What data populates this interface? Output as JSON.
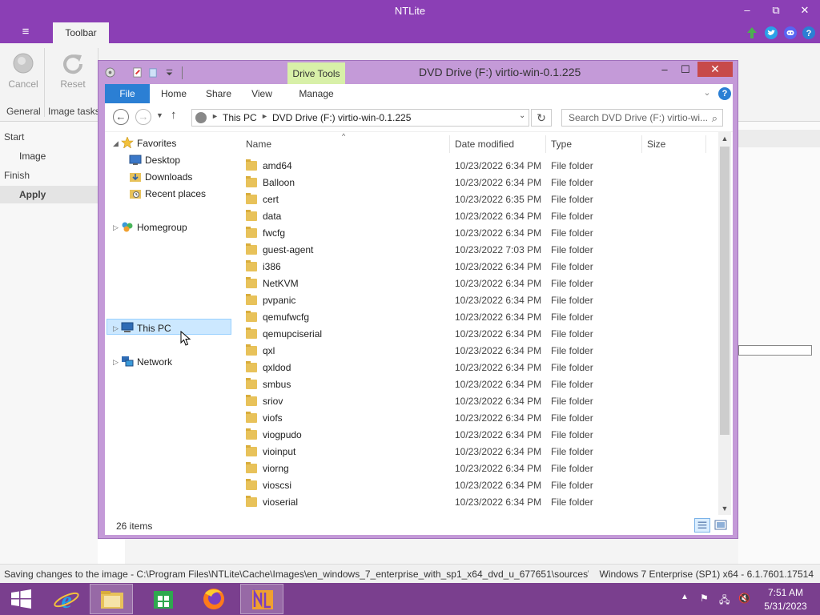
{
  "ntlite": {
    "title": "NTLite",
    "window_controls": {
      "minimize": "–",
      "restore": "⧉",
      "close": "✕"
    },
    "menu_glyph": "≡",
    "ribbon_tab": "Toolbar",
    "ribbon": {
      "cancel": "Cancel",
      "reset": "Reset",
      "group_general": "General",
      "group_image_tasks": "Image tasks"
    },
    "nav": {
      "start": "Start",
      "image": "Image",
      "finish": "Finish",
      "apply": "Apply"
    },
    "status_left": "Saving changes to the image - C:\\Program Files\\NTLite\\Cache\\Images\\en_windows_7_enterprise_with_sp1_x64_dvd_u_677651\\sources\\i...",
    "status_right": "Windows 7 Enterprise (SP1) x64 - 6.1.7601.17514"
  },
  "explorer": {
    "title": "DVD Drive (F:) virtio-win-0.1.225",
    "contextual_tab": "Drive Tools",
    "window_controls": {
      "minimize": "–",
      "maximize": "☐",
      "close": "✕"
    },
    "tabs": {
      "file": "File",
      "home": "Home",
      "share": "Share",
      "view": "View",
      "manage": "Manage"
    },
    "help": "?",
    "address": {
      "parts": [
        "This PC",
        "DVD Drive (F:) virtio-win-0.1.225"
      ],
      "sep": "►"
    },
    "search_placeholder": "Search DVD Drive (F:) virtio-wi...",
    "nav_tree": {
      "favorites": "Favorites",
      "desktop": "Desktop",
      "downloads": "Downloads",
      "recent": "Recent places",
      "homegroup": "Homegroup",
      "this_pc": "This PC",
      "network": "Network"
    },
    "columns": {
      "name": "Name",
      "date": "Date modified",
      "type": "Type",
      "size": "Size"
    },
    "files": [
      {
        "name": "amd64",
        "date": "10/23/2022 6:34 PM",
        "type": "File folder"
      },
      {
        "name": "Balloon",
        "date": "10/23/2022 6:34 PM",
        "type": "File folder"
      },
      {
        "name": "cert",
        "date": "10/23/2022 6:35 PM",
        "type": "File folder"
      },
      {
        "name": "data",
        "date": "10/23/2022 6:34 PM",
        "type": "File folder"
      },
      {
        "name": "fwcfg",
        "date": "10/23/2022 6:34 PM",
        "type": "File folder"
      },
      {
        "name": "guest-agent",
        "date": "10/23/2022 7:03 PM",
        "type": "File folder"
      },
      {
        "name": "i386",
        "date": "10/23/2022 6:34 PM",
        "type": "File folder"
      },
      {
        "name": "NetKVM",
        "date": "10/23/2022 6:34 PM",
        "type": "File folder"
      },
      {
        "name": "pvpanic",
        "date": "10/23/2022 6:34 PM",
        "type": "File folder"
      },
      {
        "name": "qemufwcfg",
        "date": "10/23/2022 6:34 PM",
        "type": "File folder"
      },
      {
        "name": "qemupciserial",
        "date": "10/23/2022 6:34 PM",
        "type": "File folder"
      },
      {
        "name": "qxl",
        "date": "10/23/2022 6:34 PM",
        "type": "File folder"
      },
      {
        "name": "qxldod",
        "date": "10/23/2022 6:34 PM",
        "type": "File folder"
      },
      {
        "name": "smbus",
        "date": "10/23/2022 6:34 PM",
        "type": "File folder"
      },
      {
        "name": "sriov",
        "date": "10/23/2022 6:34 PM",
        "type": "File folder"
      },
      {
        "name": "viofs",
        "date": "10/23/2022 6:34 PM",
        "type": "File folder"
      },
      {
        "name": "viogpudo",
        "date": "10/23/2022 6:34 PM",
        "type": "File folder"
      },
      {
        "name": "vioinput",
        "date": "10/23/2022 6:34 PM",
        "type": "File folder"
      },
      {
        "name": "viorng",
        "date": "10/23/2022 6:34 PM",
        "type": "File folder"
      },
      {
        "name": "vioscsi",
        "date": "10/23/2022 6:34 PM",
        "type": "File folder"
      },
      {
        "name": "vioserial",
        "date": "10/23/2022 6:34 PM",
        "type": "File folder"
      }
    ],
    "item_count": "26 items"
  },
  "taskbar": {
    "apps": [
      "windows-start-icon",
      "internet-explorer-icon",
      "file-explorer-icon",
      "store-icon",
      "firefox-icon",
      "ntlite-icon"
    ],
    "time": "7:51 AM",
    "date": "5/31/2023"
  },
  "colors": {
    "ntlite_accent": "#8b3fb5",
    "explorer_frame": "#c49ad8",
    "file_tab": "#2b7fd4",
    "drive_tools": "#d8f0a8",
    "taskbar": "#7a3f8e",
    "folder": "#e8c25a"
  }
}
